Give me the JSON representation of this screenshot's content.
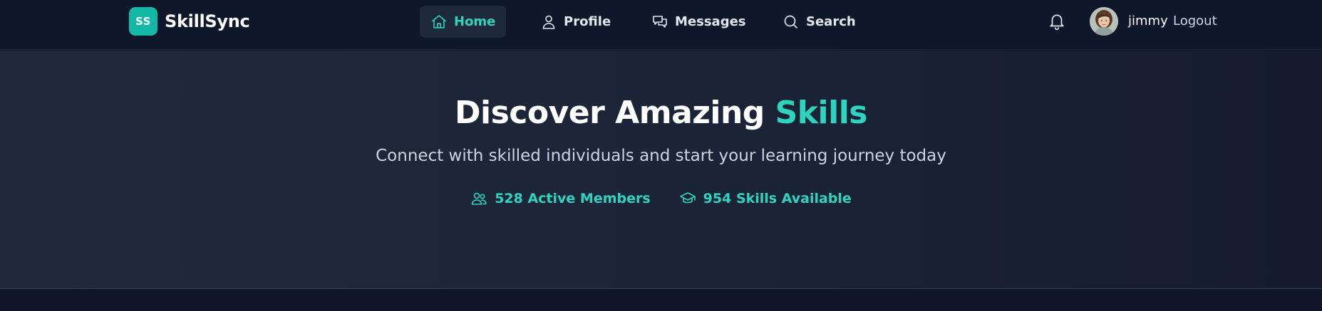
{
  "brand": {
    "logo_text": "SS",
    "name": "SkillSync"
  },
  "nav": {
    "items": [
      {
        "label": "Home",
        "icon": "home-icon",
        "active": true
      },
      {
        "label": "Profile",
        "icon": "user-icon",
        "active": false
      },
      {
        "label": "Messages",
        "icon": "chat-icon",
        "active": false
      },
      {
        "label": "Search",
        "icon": "search-icon",
        "active": false
      }
    ]
  },
  "user": {
    "username": "jimmy",
    "logout_label": "Logout",
    "notification_icon": "bell-icon"
  },
  "hero": {
    "title_prefix": "Discover Amazing",
    "title_accent": "Skills",
    "subtitle": "Connect with skilled individuals and start your learning journey today",
    "stats": [
      {
        "text": "528 Active Members",
        "icon": "users-icon"
      },
      {
        "text": "954 Skills Available",
        "icon": "graduation-cap-icon"
      }
    ]
  },
  "colors": {
    "accent": "#2dd4bf",
    "background": "#0f172a",
    "logo_bg": "#14b8a6"
  }
}
